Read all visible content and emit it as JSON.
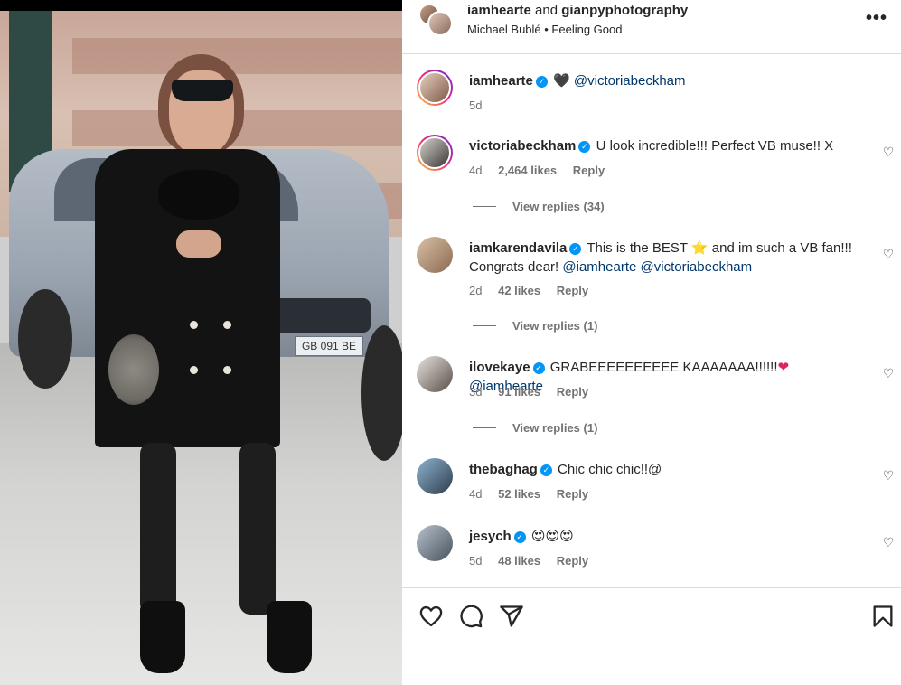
{
  "post": {
    "author": "iamhearte",
    "and_text": "and",
    "collaborator": "gianpyphotography",
    "audio": "Michael Bublé • Feeling Good"
  },
  "caption": {
    "username": "iamhearte",
    "heart": "🖤",
    "mention": "@victoriabeckham",
    "time": "5d"
  },
  "comments": [
    {
      "username": "victoriabeckham",
      "verified": true,
      "text": "U look incredible!!! Perfect VB muse!! X",
      "time": "4d",
      "likes": "2,464 likes",
      "reply": "Reply",
      "view_replies": "View replies (34)"
    },
    {
      "username": "iamkarendavila",
      "verified": true,
      "text_1": "This is the BEST",
      "star": "⭐",
      "text_2": "and im such a VB fan!!! Congrats dear!",
      "mention_1": "@iamhearte",
      "mention_2": "@victoriabeckham",
      "time": "2d",
      "likes": "42 likes",
      "reply": "Reply",
      "view_replies": "View replies (1)"
    },
    {
      "username": "ilovekaye",
      "verified": true,
      "text": "GRABEEEEEEEEEE KAAAAAAA!!!!!!",
      "heart": "❤",
      "mention": "@iamhearte",
      "time": "3d",
      "likes": "91 likes",
      "reply": "Reply",
      "view_replies": "View replies (1)"
    },
    {
      "username": "thebaghag",
      "verified": true,
      "text": "Chic chic chic!!@",
      "time": "4d",
      "likes": "52 likes",
      "reply": "Reply"
    },
    {
      "username": "jesych",
      "verified": true,
      "text": "😍😍😍",
      "time": "5d",
      "likes": "48 likes",
      "reply": "Reply"
    }
  ],
  "photo": {
    "plate_text": "GB 091 BE"
  },
  "icons": {
    "more": "more-options-icon",
    "like": "heart-icon",
    "comment": "comment-icon",
    "share": "share-icon",
    "save": "bookmark-icon",
    "verified": "verified-badge-icon"
  },
  "colors": {
    "verified": "#0095f6",
    "mention": "#00376b",
    "muted": "#737373",
    "border": "#dbdbdb"
  }
}
